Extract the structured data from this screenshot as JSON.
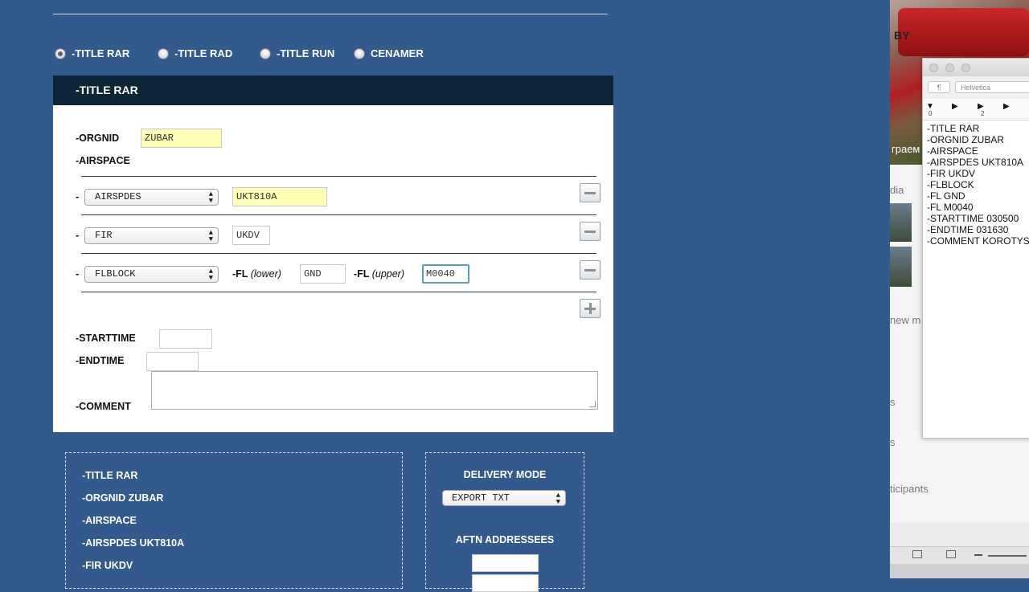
{
  "radio_options": [
    {
      "label": "-TITLE RAR",
      "selected": true
    },
    {
      "label": "-TITLE RAD",
      "selected": false
    },
    {
      "label": "-TITLE RUN",
      "selected": false
    },
    {
      "label": "CENAMER",
      "selected": false
    }
  ],
  "form": {
    "header": "-TITLE RAR",
    "orgnid_label": "-ORGNID",
    "orgnid_value": "ZUBAR",
    "airspace_label": "-AIRSPACE",
    "row_dash": "-",
    "rows": [
      {
        "select": "AIRSPDES",
        "value": "UKT810A"
      },
      {
        "select": "FIR",
        "value": "UKDV"
      },
      {
        "select": "FLBLOCK",
        "fl_prefix": "-FL",
        "lower_label": "(lower)",
        "lower_value": "GND",
        "upper_label": "(upper)",
        "upper_value": "M0040"
      }
    ],
    "starttime_label": "-STARTTIME",
    "starttime_value": "",
    "endtime_label": "-ENDTIME",
    "endtime_value": "",
    "comment_label": "-COMMENT",
    "comment_value": ""
  },
  "summary": {
    "lines": [
      "-TITLE RAR",
      "-ORGNID ZUBAR",
      "-AIRSPACE",
      "-AIRSPDES UKT810A",
      "-FIR UKDV"
    ]
  },
  "delivery": {
    "title": "DELIVERY MODE",
    "mode": "EXPORT TXT",
    "addressees_title": "AFTN ADDRESSEES"
  },
  "background_window": {
    "photo_caption": "граем в",
    "side_texts": [
      "dia",
      "new m",
      "s",
      "s",
      "ticipants"
    ]
  },
  "editor": {
    "font": "Helvetica",
    "para": "¶",
    "ruler": [
      "0",
      "2"
    ],
    "lines": [
      "-TITLE RAR",
      "-ORGNID ZUBAR",
      "-AIRSPACE",
      "-AIRSPDES UKT810A",
      "-FIR UKDV",
      "-FLBLOCK",
      "-FL GND",
      "-FL M0040",
      "-STARTTIME 030500",
      "-ENDTIME 031630",
      "-COMMENT KOROTYSHKIN"
    ]
  }
}
